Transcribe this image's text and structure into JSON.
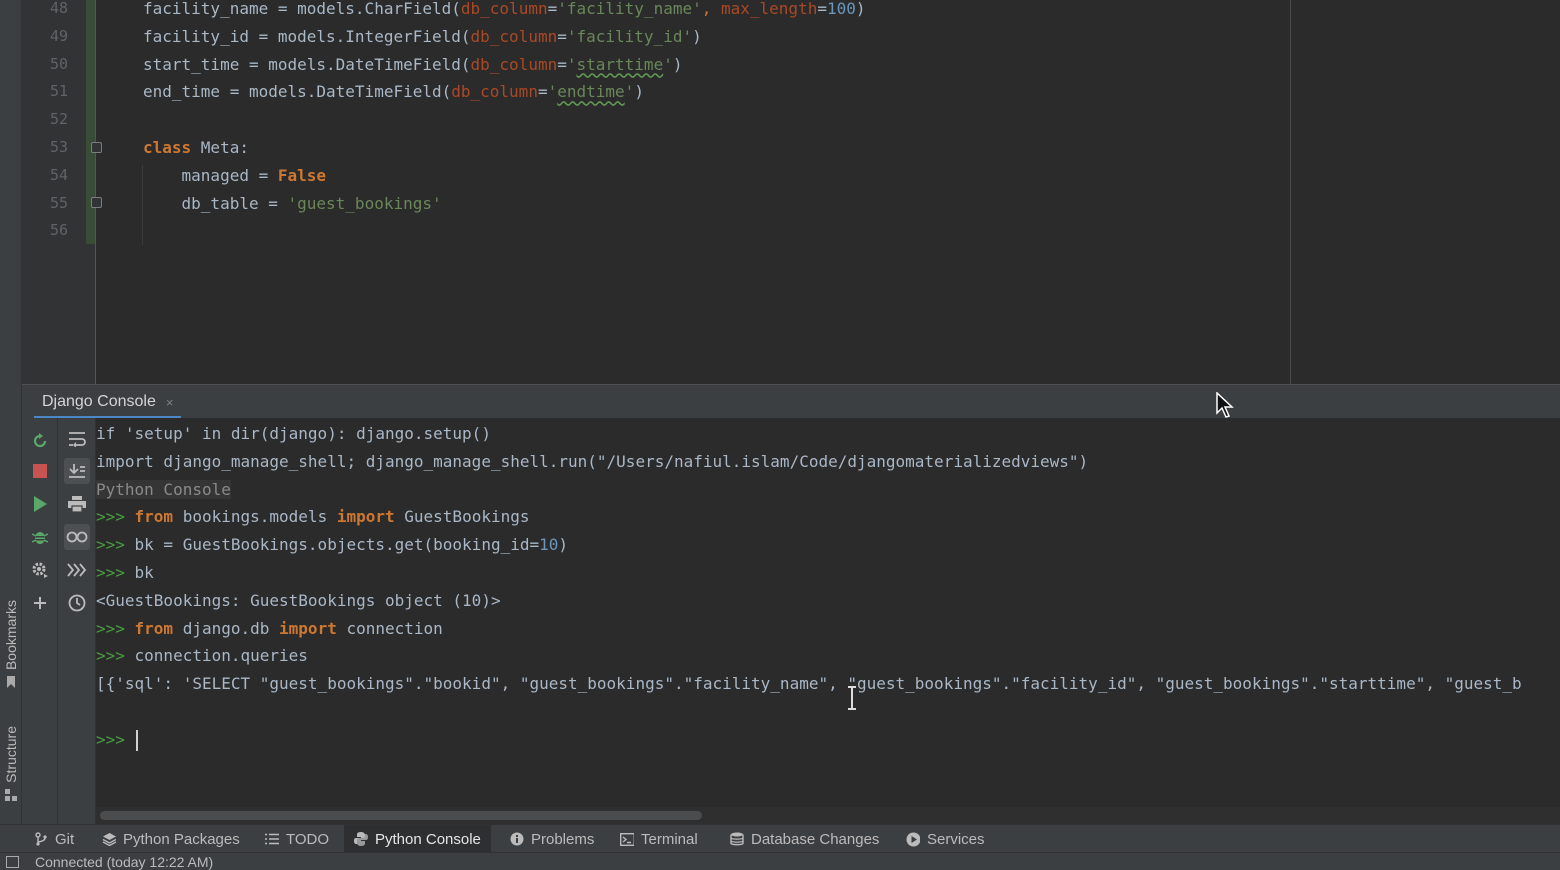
{
  "editor": {
    "line_numbers": [
      "48",
      "49",
      "50",
      "51",
      "52",
      "53",
      "54",
      "55",
      "56"
    ],
    "lines": [
      [
        {
          "t": "facility_name = models.CharField(",
          "c": "plain"
        },
        {
          "t": "db_column",
          "c": "param"
        },
        {
          "t": "=",
          "c": "plain"
        },
        {
          "t": "'facility_name'",
          "c": "str"
        },
        {
          "t": ", ",
          "c": "kw"
        },
        {
          "t": "max_length",
          "c": "param"
        },
        {
          "t": "=",
          "c": "plain"
        },
        {
          "t": "100",
          "c": "num"
        },
        {
          "t": ")",
          "c": "plain"
        }
      ],
      [
        {
          "t": "facility_id = models.IntegerField(",
          "c": "plain"
        },
        {
          "t": "db_column",
          "c": "param"
        },
        {
          "t": "=",
          "c": "plain"
        },
        {
          "t": "'facility_id'",
          "c": "str"
        },
        {
          "t": ")",
          "c": "plain"
        }
      ],
      [
        {
          "t": "start_time = models.DateTimeField(",
          "c": "plain"
        },
        {
          "t": "db_column",
          "c": "param"
        },
        {
          "t": "=",
          "c": "plain"
        },
        {
          "t": "'",
          "c": "str"
        },
        {
          "t": "starttime",
          "c": "str squig"
        },
        {
          "t": "'",
          "c": "str"
        },
        {
          "t": ")",
          "c": "plain"
        }
      ],
      [
        {
          "t": "end_time = models.DateTimeField(",
          "c": "plain"
        },
        {
          "t": "db_column",
          "c": "param"
        },
        {
          "t": "=",
          "c": "plain"
        },
        {
          "t": "'",
          "c": "str"
        },
        {
          "t": "endtime",
          "c": "str squig"
        },
        {
          "t": "'",
          "c": "str"
        },
        {
          "t": ")",
          "c": "plain"
        }
      ],
      [],
      [
        {
          "t": "class ",
          "c": "kw-b"
        },
        {
          "t": "Meta:",
          "c": "plain"
        }
      ],
      [
        {
          "t": "    managed = ",
          "c": "plain"
        },
        {
          "t": "False",
          "c": "kw-b"
        }
      ],
      [
        {
          "t": "    db_table = ",
          "c": "plain"
        },
        {
          "t": "'guest_bookings'",
          "c": "str"
        }
      ],
      []
    ]
  },
  "console": {
    "tab_label": "Django Console",
    "close_glyph": "×",
    "lines": [
      [
        {
          "t": "if 'setup' in dir(django): django.setup()",
          "c": "plain"
        }
      ],
      [
        {
          "t": "import django_manage_shell; django_manage_shell.run(\"/Users/nafiul.islam/Code/djangomaterializedviews\")",
          "c": "plain"
        }
      ],
      [
        {
          "t": "Python Console",
          "c": "sysmsg"
        }
      ],
      [
        {
          "t": ">>> ",
          "c": "prompt"
        },
        {
          "t": "from ",
          "c": "kw-b"
        },
        {
          "t": "bookings.models ",
          "c": "plain"
        },
        {
          "t": "import ",
          "c": "kw-b"
        },
        {
          "t": "GuestBookings",
          "c": "plain"
        }
      ],
      [
        {
          "t": ">>> ",
          "c": "prompt"
        },
        {
          "t": "bk = GuestBookings.objects.get(booking_id=",
          "c": "plain"
        },
        {
          "t": "10",
          "c": "num"
        },
        {
          "t": ")",
          "c": "plain"
        }
      ],
      [
        {
          "t": ">>> ",
          "c": "prompt"
        },
        {
          "t": "bk",
          "c": "plain"
        }
      ],
      [
        {
          "t": "<GuestBookings: GuestBookings object (10)>",
          "c": "plain"
        }
      ],
      [
        {
          "t": ">>> ",
          "c": "prompt"
        },
        {
          "t": "from ",
          "c": "kw-b"
        },
        {
          "t": "django.db ",
          "c": "plain"
        },
        {
          "t": "import ",
          "c": "kw-b"
        },
        {
          "t": "connection",
          "c": "plain"
        }
      ],
      [
        {
          "t": ">>> ",
          "c": "prompt"
        },
        {
          "t": "connection.queries",
          "c": "plain"
        }
      ],
      [
        {
          "t": "[{'sql': 'SELECT \"guest_bookings\".\"bookid\", \"guest_bookings\".\"facility_name\", \"guest_bookings\".\"facility_id\", \"guest_bookings\".\"starttime\", \"guest_b",
          "c": "plain"
        }
      ],
      [],
      [
        {
          "t": ">>> ",
          "c": "prompt"
        }
      ]
    ],
    "tools_left": [
      "rerun-icon",
      "stop-icon",
      "run-icon",
      "debug-icon",
      "settings-icon",
      "add-icon"
    ],
    "tools_right": [
      "soft-wrap-icon",
      "scroll-to-end-icon",
      "print-icon",
      "glasses-icon",
      "execute-icon",
      "history-icon"
    ]
  },
  "left_strip": {
    "bookmarks_label": "Bookmarks",
    "structure_label": "Structure"
  },
  "toolbar": {
    "items": [
      {
        "label": "Git",
        "icon": "git-branch-icon",
        "active": false
      },
      {
        "label": "Python Packages",
        "icon": "layers-icon",
        "active": false
      },
      {
        "label": "TODO",
        "icon": "list-icon",
        "active": false
      },
      {
        "label": "Python Console",
        "icon": "python-icon",
        "active": true
      },
      {
        "label": "Problems",
        "icon": "info-icon",
        "active": false
      },
      {
        "label": "Terminal",
        "icon": "terminal-icon",
        "active": false
      },
      {
        "label": "Database Changes",
        "icon": "database-icon",
        "active": false
      },
      {
        "label": "Services",
        "icon": "services-icon",
        "active": false
      }
    ]
  },
  "status": {
    "text": "Connected (today 12:22 AM)"
  },
  "colors": {
    "background": "#2b2b2b",
    "panel": "#3c3f41",
    "keyword": "#cc7832",
    "string": "#6a8759",
    "number": "#6897bb",
    "parameter": "#aa4926",
    "prompt": "#4a9b43",
    "accent": "#4a88c7"
  }
}
